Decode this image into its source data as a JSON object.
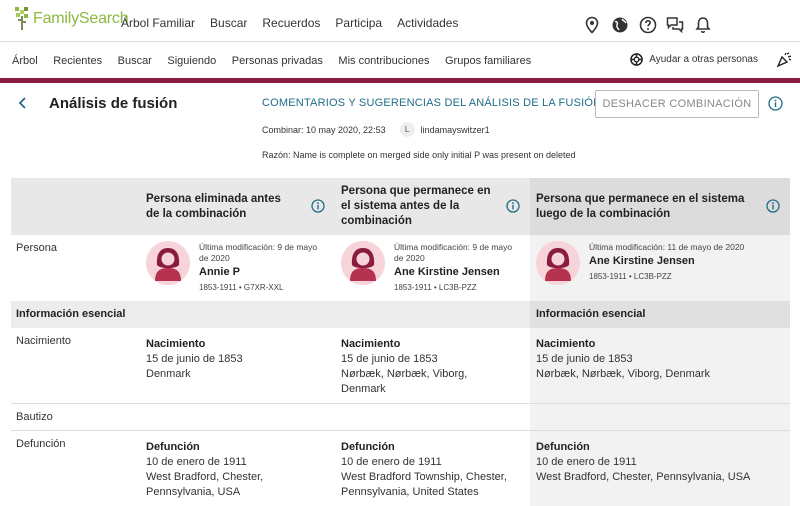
{
  "brand": {
    "name": "FamilySearch"
  },
  "top_nav": [
    "Árbol Familiar",
    "Buscar",
    "Recuerdos",
    "Participa",
    "Actividades"
  ],
  "top_icons": [
    "map-pin-icon",
    "globe-icon",
    "help-icon",
    "chat-icon",
    "bell-icon"
  ],
  "sub_nav": [
    "Árbol",
    "Recientes",
    "Buscar",
    "Siguiendo",
    "Personas privadas",
    "Mis contribuciones",
    "Grupos familiares"
  ],
  "help_others": "Ayudar a otras personas",
  "header": {
    "title": "Análisis de fusión",
    "comments_link": "COMENTARIOS Y SUGERENCIAS DEL ANÁLISIS DE LA FUSIÓN",
    "undo_button": "DESHACER COMBINACIÓN",
    "merge_label": "Combinar: 10 may 2020, 22:53",
    "user_initial": "L",
    "user_name": "lindamayswitzer1",
    "reason": "Razón: Name is complete on merged side only initial P was present on deleted"
  },
  "columns": [
    {
      "title_lines": [
        "Persona eliminada antes",
        "de la combinación"
      ]
    },
    {
      "title_lines": [
        "Persona que permanece en",
        "el sistema antes de la",
        "combinación"
      ]
    },
    {
      "title_lines": [
        "Persona que permanece en el sistema",
        "luego de la combinación"
      ]
    }
  ],
  "row_labels": {
    "person": "Persona",
    "essential": "Información esencial",
    "birth": "Nacimiento",
    "baptism": "Bautizo",
    "death": "Defunción"
  },
  "persons": [
    {
      "mod_lines": [
        "Última modificación: 9 de mayo",
        "de 2020"
      ],
      "name": "Annie P",
      "dates": "1853-1911 • G7XR-XXL"
    },
    {
      "mod_lines": [
        "Última modificación: 9 de mayo",
        "de 2020"
      ],
      "name": "Ane Kirstine Jensen",
      "dates": "1853-1911 • LC3B-PZZ"
    },
    {
      "mod_lines": [
        "Última modificación: 11 de mayo de 2020"
      ],
      "name": "Ane Kirstine Jensen",
      "dates": "1853-1911 • LC3B-PZZ"
    }
  ],
  "essential_right": "Información esencial",
  "birth": [
    {
      "title": "Nacimiento",
      "lines": [
        "15 de junio de 1853",
        "Denmark"
      ]
    },
    {
      "title": "Nacimiento",
      "lines": [
        "15 de junio de 1853",
        "Nørbæk, Nørbæk, Viborg,",
        "Denmark"
      ]
    },
    {
      "title": "Nacimiento",
      "lines": [
        "15 de junio de 1853",
        "Nørbæk, Nørbæk, Viborg, Denmark"
      ]
    }
  ],
  "death": [
    {
      "title": "Defunción",
      "lines": [
        "10 de enero de 1911",
        "West Bradford, Chester,",
        "Pennsylvania, USA"
      ]
    },
    {
      "title": "Defunción",
      "lines": [
        "10 de enero de 1911",
        "West Bradford Township, Chester,",
        "Pennsylvania, United States"
      ]
    },
    {
      "title": "Defunción",
      "lines": [
        "10 de enero de 1911",
        "West Bradford, Chester, Pennsylvania, USA"
      ]
    }
  ],
  "colors": {
    "accent_red": "#8a1c3d",
    "link_blue": "#1e6c88",
    "brand_green": "#8cb83e",
    "avatar_pink": "#f6d4d9",
    "avatar_dark": "#b5334f"
  }
}
